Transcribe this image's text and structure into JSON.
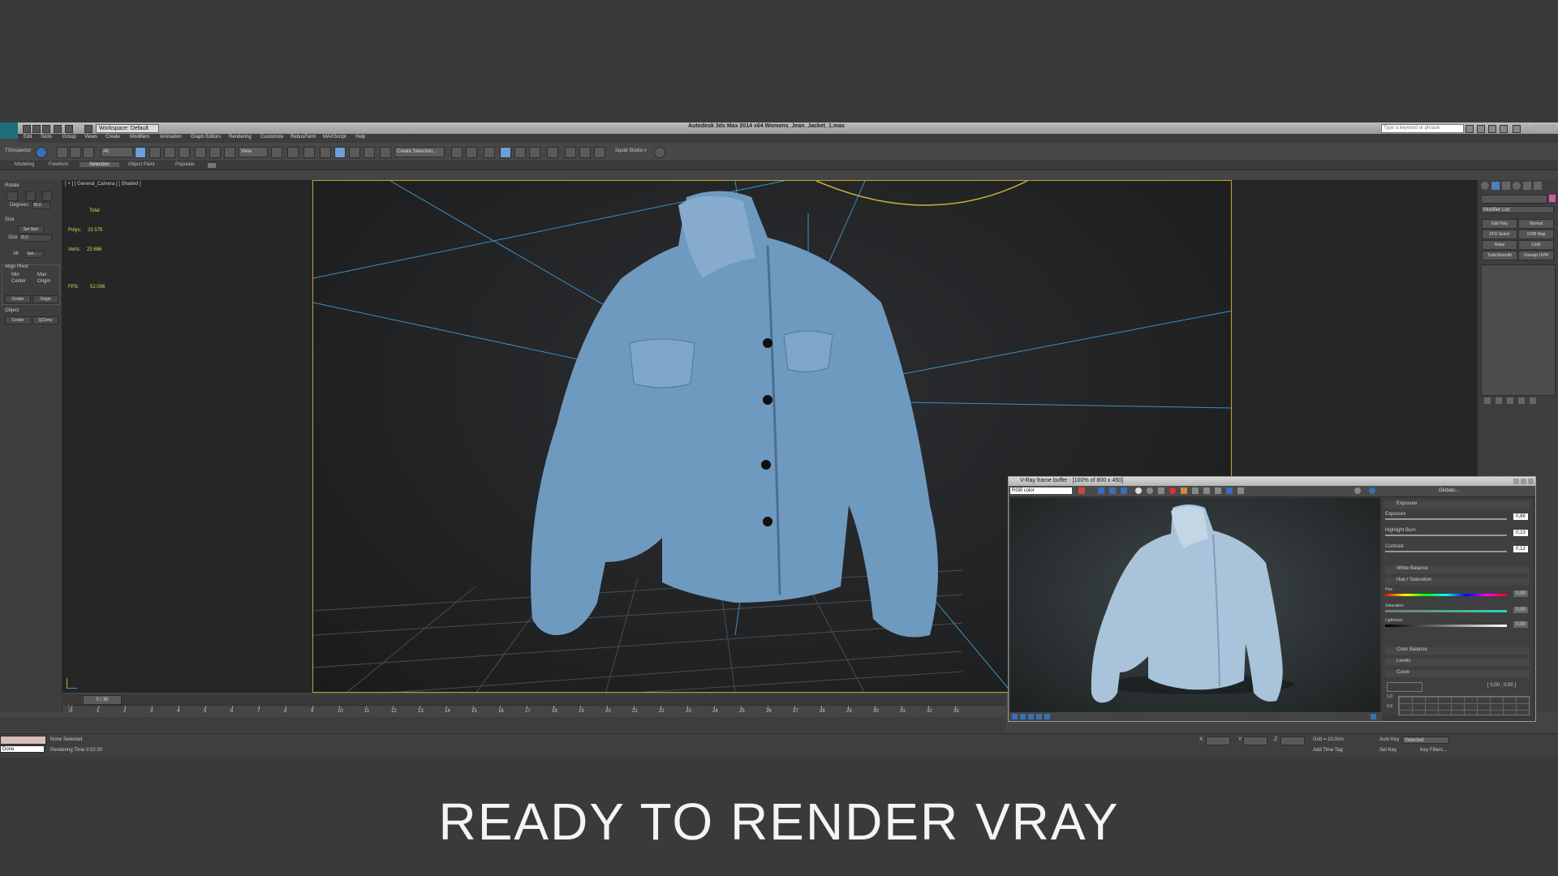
{
  "window": {
    "title": "Autodesk 3ds Max  2014 x64     Womens_Jean_Jacket_1.max",
    "workspace": "Workspace: Default",
    "search_placeholder": "Type a keyword or phrase"
  },
  "menu": [
    "Edit",
    "Tools",
    "Group",
    "Views",
    "Create",
    "Modifiers",
    "Animation",
    "Graph Editors",
    "Rendering",
    "Customize",
    "RebusFarm",
    "MAXScript",
    "Help"
  ],
  "toolbar": {
    "inspector": "TSInspector",
    "filter": "All",
    "view": "View",
    "selection_set": "Create Selection...",
    "squid": "Squid Studio v"
  },
  "ribbon": [
    "Modeling",
    "Freeform",
    "Selection",
    "Object Paint",
    "Populate"
  ],
  "left_panel": {
    "rotate": "Rotate",
    "degrees_label": "Degrees:",
    "degrees_value": "90,0",
    "size": "Size",
    "set_size": "Set Size",
    "size_label": "Size",
    "size_value": "20,0",
    "all": "All",
    "get": "Get...",
    "align_pivot": "Align Pivot",
    "min": "Min",
    "max": "Max",
    "center": "Center",
    "origin": "Origin",
    "center_btn": "Center",
    "origin_btn": "Origin",
    "object": "Object",
    "obj_center": "Center",
    "qclone": "QClone"
  },
  "viewport": {
    "label": "[ + ] [ General_Camera ] [ Shaded ]",
    "stats_total": "Total",
    "polys_label": "Polys:",
    "polys": "23 575",
    "verts_label": "Verts:",
    "verts": "23 686",
    "fps_label": "FPS:",
    "fps": "52,006"
  },
  "right_panel": {
    "modifier_list": "Modifier List",
    "buttons": [
      "Edit Poly",
      "Normal",
      "FFD Select",
      "UVW Map",
      "Relax",
      "Cloth",
      "TurboSmooth",
      "Unwrap UVW"
    ]
  },
  "timeline": {
    "slider": "0 / 30",
    "ticks": [
      "0",
      "1",
      "2",
      "3",
      "4",
      "5",
      "6",
      "7",
      "8",
      "9",
      "10",
      "11",
      "12",
      "13",
      "14",
      "15",
      "16",
      "17",
      "18",
      "19",
      "20",
      "21",
      "22",
      "23",
      "24",
      "25",
      "26",
      "27",
      "28",
      "29",
      "30",
      "31",
      "32",
      "33"
    ]
  },
  "status": {
    "none_selected": "None Selected",
    "rendering_time": "Rendering Time  0:02:30",
    "done": "Done",
    "grid": "Grid = 10,0cm",
    "add_time_tag": "Add Time Tag",
    "auto_key": "Auto Key",
    "selected": "Selected",
    "set_key": "Set Key",
    "key_filters": "Key Filters...",
    "x": "X:",
    "y": "Y:",
    "z": "Z:"
  },
  "vfb": {
    "title": "V-Ray frame buffer - [100% of 800 x 450]",
    "channel": "RGB color",
    "globals": "Globals...",
    "exposure": "Exposure",
    "exposure_label": "Exposure",
    "exposure_value": "0,86",
    "highlight_label": "Highlight Burn",
    "highlight_value": "0,13",
    "contrast_label": "Contrast",
    "contrast_value": "0,12",
    "white_balance": "White Balance",
    "hue_sat": "Hue / Saturation",
    "hue_label": "Hue",
    "hue_value": "0,00",
    "sat_label": "Saturation",
    "sat_value": "0,00",
    "light_label": "Lightness",
    "light_value": "0,00",
    "color_balance": "Color Balance",
    "levels": "Levels",
    "curve": "Curve",
    "curve_readout": "[ 0,00 ; 0,00 ]",
    "curve_y1": "1,0",
    "curve_y2": "0,9"
  },
  "banner": "READY TO RENDER  VRAY"
}
